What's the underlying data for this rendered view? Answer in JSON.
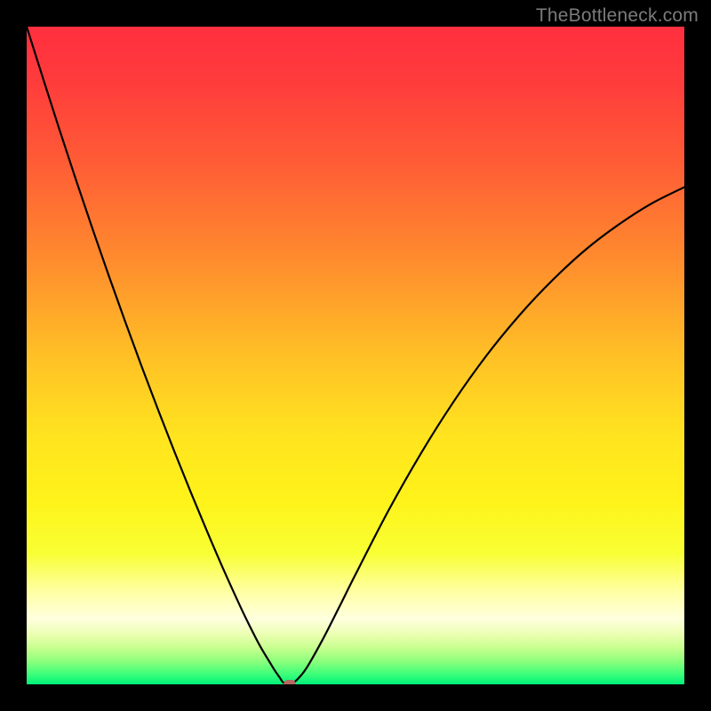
{
  "watermark": "TheBottleneck.com",
  "chart_data": {
    "type": "line",
    "title": "",
    "xlabel": "",
    "ylabel": "",
    "xlim": [
      0,
      100
    ],
    "ylim": [
      0,
      100
    ],
    "background_gradient_stops": [
      {
        "offset": 0.0,
        "color": "#ff2f3f"
      },
      {
        "offset": 0.08,
        "color": "#ff3b3c"
      },
      {
        "offset": 0.2,
        "color": "#ff5a36"
      },
      {
        "offset": 0.35,
        "color": "#ff8a2e"
      },
      {
        "offset": 0.5,
        "color": "#ffc026"
      },
      {
        "offset": 0.62,
        "color": "#ffe31f"
      },
      {
        "offset": 0.72,
        "color": "#fff31a"
      },
      {
        "offset": 0.8,
        "color": "#f8ff33"
      },
      {
        "offset": 0.86,
        "color": "#ffffa5"
      },
      {
        "offset": 0.9,
        "color": "#ffffdf"
      },
      {
        "offset": 0.925,
        "color": "#eaffb0"
      },
      {
        "offset": 0.945,
        "color": "#c6ff8e"
      },
      {
        "offset": 0.965,
        "color": "#8cff7c"
      },
      {
        "offset": 0.985,
        "color": "#3bff7a"
      },
      {
        "offset": 1.0,
        "color": "#00f07a"
      }
    ],
    "series": [
      {
        "name": "bottleneck-curve",
        "x": [
          0.0,
          2.5,
          5.0,
          7.5,
          10.0,
          12.5,
          15.0,
          17.5,
          20.0,
          22.5,
          25.0,
          27.5,
          30.0,
          32.5,
          34.0,
          35.5,
          37.0,
          37.8,
          38.5,
          39.0,
          40.0,
          41.0,
          42.5,
          45.0,
          47.5,
          50.0,
          55.0,
          60.0,
          65.0,
          70.0,
          75.0,
          80.0,
          85.0,
          90.0,
          95.0,
          100.0
        ],
        "y": [
          100.0,
          92.1,
          84.3,
          76.7,
          69.3,
          62.1,
          55.1,
          48.3,
          41.7,
          35.3,
          29.1,
          23.1,
          17.3,
          11.8,
          8.7,
          5.8,
          3.3,
          2.0,
          1.0,
          0.3,
          0.0,
          0.6,
          2.4,
          6.8,
          11.7,
          16.7,
          26.4,
          35.2,
          43.1,
          50.1,
          56.2,
          61.5,
          66.1,
          69.9,
          73.1,
          75.6
        ]
      }
    ],
    "marker": {
      "x": 40.0,
      "y": 0.0
    },
    "annotations": []
  }
}
